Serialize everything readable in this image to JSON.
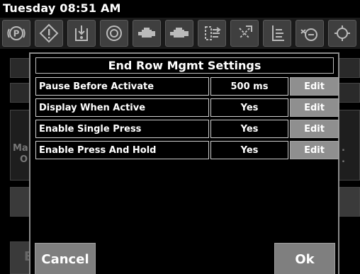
{
  "status_bar": {
    "datetime": "Tuesday 08:51 AM"
  },
  "icon_bar": {
    "icons": [
      "parking-brake-icon",
      "warning-icon",
      "hitch-lower-icon",
      "pto-icon",
      "engine-speed-icon",
      "engine-icon",
      "hydraulic-valve-icon",
      "valve-disabled-icon",
      "hitch-raise-icon",
      "hydraulic-pump-icon",
      "differential-lock-icon"
    ]
  },
  "background": {
    "left_text": "Ma",
    "left_text_2": "O",
    "left_button_fragment": "E"
  },
  "dialog": {
    "title": "End Row Mgmt Settings",
    "rows": [
      {
        "label": "Pause Before Activate",
        "value": "500 ms",
        "edit": "Edit"
      },
      {
        "label": "Display When Active",
        "value": "Yes",
        "edit": "Edit"
      },
      {
        "label": "Enable Single Press",
        "value": "Yes",
        "edit": "Edit"
      },
      {
        "label": "Enable Press And Hold",
        "value": "Yes",
        "edit": "Edit"
      }
    ],
    "cancel_label": "Cancel",
    "ok_label": "Ok"
  }
}
